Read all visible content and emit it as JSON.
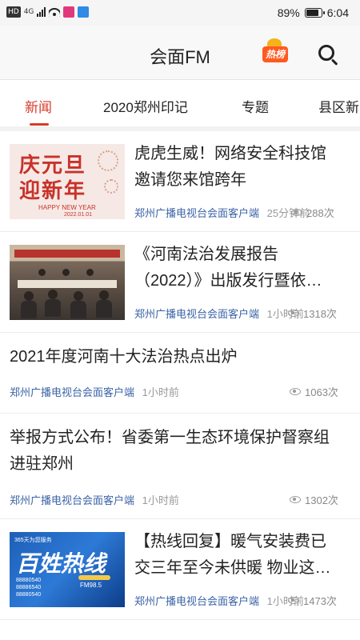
{
  "status_bar": {
    "left_chip": "HD",
    "network_type": "4G",
    "battery_percent": "89%",
    "battery_level": 0.89,
    "time": "6:04"
  },
  "header": {
    "title": "会面FM",
    "hot_badge_label": "热榜",
    "search_icon": "search-icon"
  },
  "tabs": [
    {
      "label": "新闻",
      "active": true
    },
    {
      "label": "2020郑州印记",
      "active": false
    },
    {
      "label": "专题",
      "active": false
    },
    {
      "label": "县区新",
      "active": false
    }
  ],
  "accent_color": "#d83a2a",
  "news": [
    {
      "title_lines": [
        "虎虎生威！网络安全科技馆",
        "邀请您来馆跨年"
      ],
      "source": "郑州广播电视台会面客户端",
      "time": "25分钟前",
      "views": "288次",
      "thumbnail": {
        "line1": "庆元旦",
        "line2": "迎新年",
        "caption": "HAPPY NEW YEAR",
        "date": "2022.01.01"
      }
    },
    {
      "title_lines": [
        "《河南法治发展报告",
        "（2022）》出版发行暨依…"
      ],
      "source": "郑州广播电视台会面客户端",
      "time": "1小时前",
      "views": "1318次"
    },
    {
      "title_lines": [
        "2021年度河南十大法治热点出炉"
      ],
      "source": "郑州广播电视台会面客户端",
      "time": "1小时前",
      "views": "1063次"
    },
    {
      "title_lines": [
        "举报方式公布！省委第一生态环境保护督察组",
        "进驻郑州"
      ],
      "source": "郑州广播电视台会面客户端",
      "time": "1小时前",
      "views": "1302次"
    },
    {
      "title_lines": [
        "【热线回复】暖气安装费已",
        "交三年至今未供暖 物业这…"
      ],
      "source": "郑州广播电视台会面客户端",
      "time": "1小时前",
      "views": "1473次",
      "thumbnail": {
        "headline": "百姓热线",
        "top_text": "365天为您服务",
        "fm_label": "FM98.5",
        "numbers": [
          "88880540",
          "88886540",
          "88880540"
        ]
      }
    }
  ]
}
